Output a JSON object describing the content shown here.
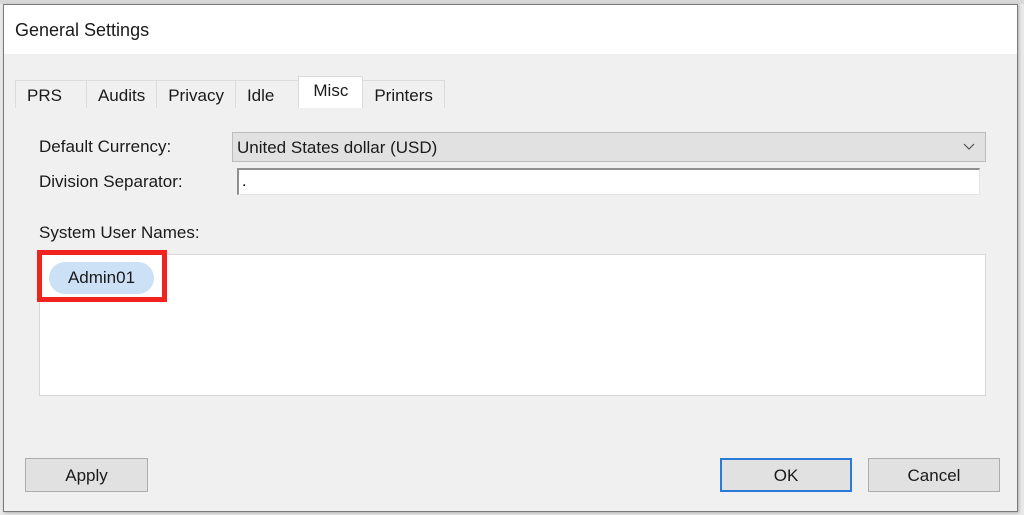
{
  "dialog": {
    "title": "General Settings"
  },
  "tabs": [
    {
      "label": "PRS",
      "active": false
    },
    {
      "label": "Audits",
      "active": false
    },
    {
      "label": "Privacy",
      "active": false
    },
    {
      "label": "Idle",
      "active": false
    },
    {
      "label": "Misc",
      "active": true
    },
    {
      "label": "Printers",
      "active": false
    }
  ],
  "misc": {
    "default_currency_label": "Default Currency:",
    "default_currency_value": "United States dollar (USD)",
    "division_separator_label": "Division Separator:",
    "division_separator_value": ".",
    "system_user_names_label": "System User Names:",
    "system_user_names": [
      "Admin01"
    ]
  },
  "buttons": {
    "apply": "Apply",
    "ok": "OK",
    "cancel": "Cancel"
  },
  "icons": {
    "dropdown": "chevron-down-icon"
  },
  "colors": {
    "highlight": "#f0231f",
    "chip_bg": "#cce0f6",
    "focus_border": "#2b7ad9"
  }
}
